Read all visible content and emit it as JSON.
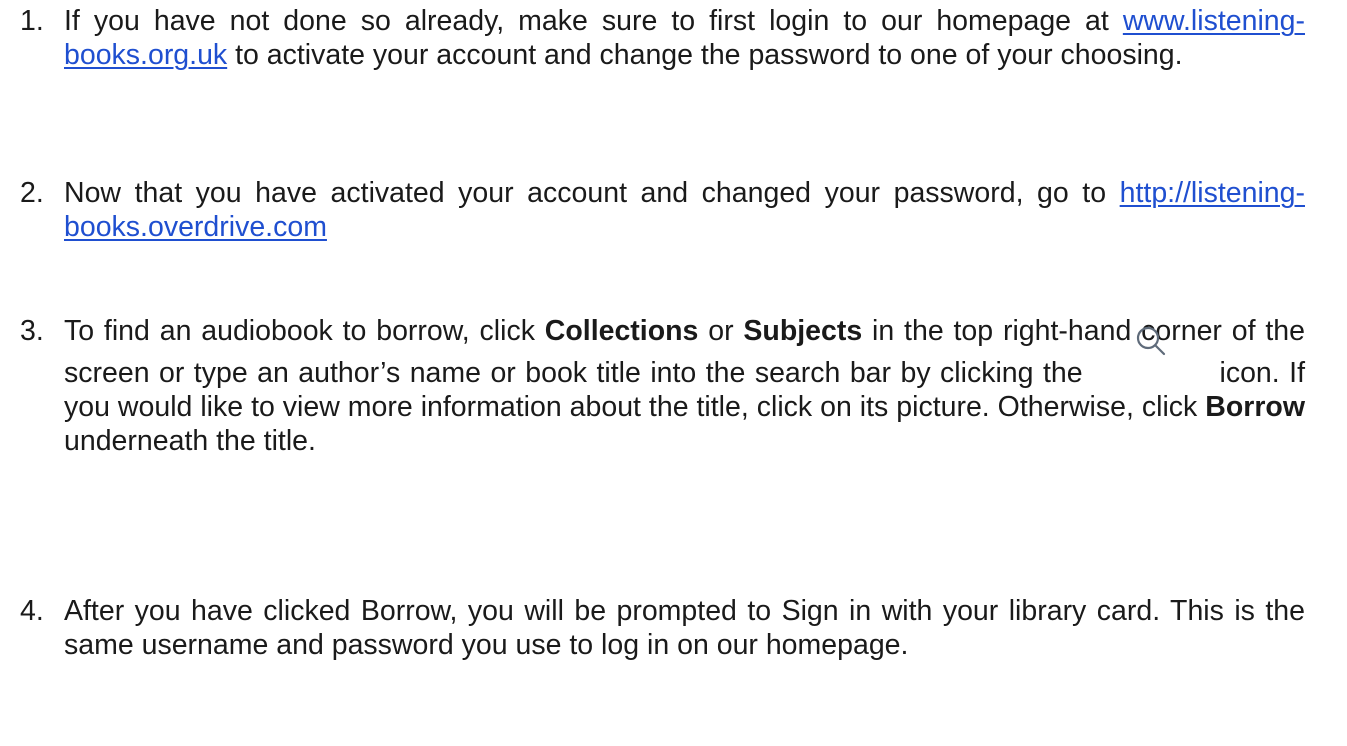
{
  "steps": [
    {
      "number": "1.",
      "text_before": "If you have not done so already, make sure to first login to our homepage at ",
      "link": "www.listening-books.org.uk",
      "text_after": " to activate your account and change the password to one of your choosing."
    },
    {
      "number": "2.",
      "text_before": "Now that you have activated your account and changed your password, go to ",
      "link": "http://listening-books.overdrive.com"
    },
    {
      "number": "3.",
      "text_a": "To find an audiobook to borrow, click ",
      "bold_a": "Collections",
      "text_b": " or ",
      "bold_b": "Subjects",
      "text_c": " in the top right-hand corner of the screen or type an author’s name or book title into the search bar by clicking the ",
      "icon": "search-icon",
      "text_d": " icon. If you would like to view more information about the title, click on its picture. Otherwise, click ",
      "bold_c": "Borrow",
      "text_e": " underneath the title."
    },
    {
      "number": "4.",
      "text": "After you have clicked Borrow, you will be prompted to Sign in with your library card. This is the same username and password you use to log in on our homepage."
    }
  ],
  "colors": {
    "text": "#1a1a1a",
    "link": "#1f4fd0",
    "icon": "#5f6b7a"
  }
}
